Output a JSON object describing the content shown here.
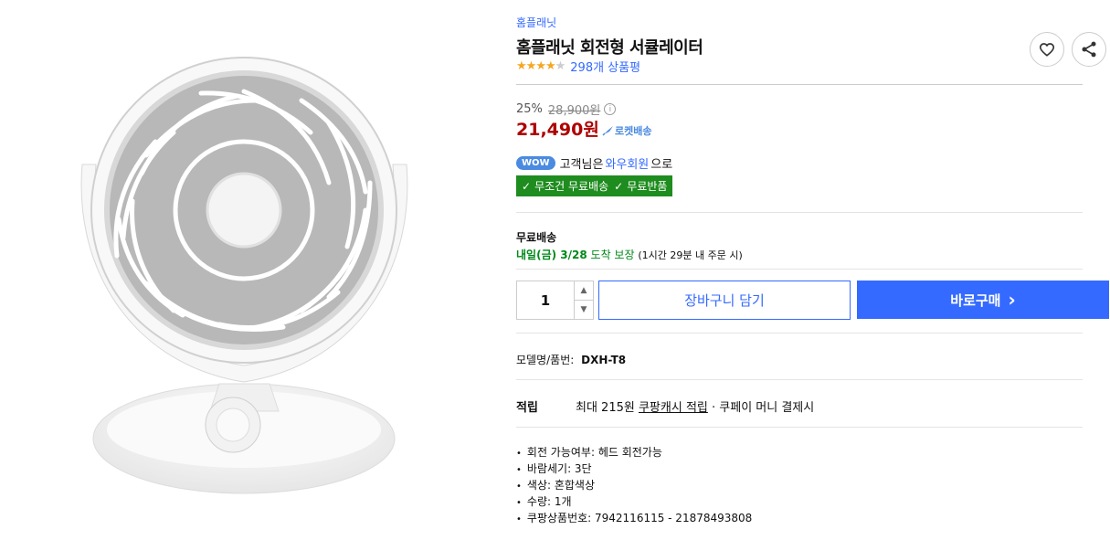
{
  "product": {
    "brand": "홈플래닛",
    "title": "홈플래닛 회전형 서큘레이터",
    "rating": 4,
    "rating_max": 5,
    "review_count": "298개 상품평",
    "image_icon": "circulator-fan-image"
  },
  "actions": {
    "wishlist_icon": "heart-icon",
    "share_icon": "share-icon"
  },
  "price": {
    "discount_rate": "25%",
    "original_price": "28,900원",
    "sale_price": "21,490원",
    "rocket_label": "로켓배송"
  },
  "membership": {
    "wow_badge": "WOW",
    "text_before": "고객님은",
    "link": "와우회원",
    "text_after": "으로",
    "benefit_1": "무조건 무료배송",
    "benefit_2": "무료반품"
  },
  "shipping": {
    "title": "무료배송",
    "date_highlight": "내일(금) 3/28",
    "date_suffix": "도착 보장",
    "note": "(1시간 29분 내 주문 시)"
  },
  "purchase": {
    "quantity": "1",
    "cart_label": "장바구니 담기",
    "buy_label": "바로구매",
    "buy_arrow": "›"
  },
  "model": {
    "label": "모델명/품번:",
    "value": "DXH-T8"
  },
  "points": {
    "label": "적립",
    "prefix": "최대 215원",
    "link": "쿠팡캐시 적립",
    "suffix": "· 쿠페이 머니 결제시"
  },
  "details": [
    "회전 가능여부: 헤드 회전가능",
    "바람세기: 3단",
    "색상: 혼합색상",
    "수량: 1개",
    "쿠팡상품번호: 7942116115 - 21878493808"
  ],
  "colors": {
    "accent": "#346aff",
    "price": "#ae0000",
    "green": "#1e8c1e",
    "star": "#f5a623"
  }
}
